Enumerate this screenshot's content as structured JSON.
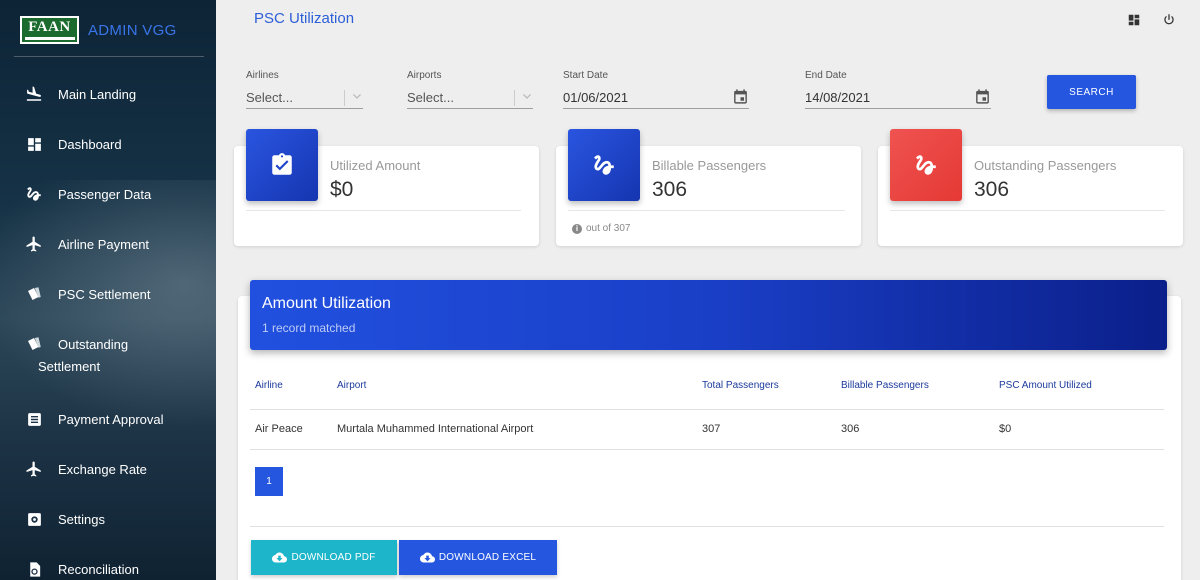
{
  "brand": {
    "logo_text": "FAAN",
    "title": "ADMIN VGG"
  },
  "nav": [
    {
      "label": "Main Landing",
      "icon": "plane-landing-icon"
    },
    {
      "label": "Dashboard",
      "icon": "dashboard-icon"
    },
    {
      "label": "Passenger Data",
      "icon": "seat-icon"
    },
    {
      "label": "Airline Payment",
      "icon": "airplane-icon"
    },
    {
      "label": "PSC Settlement",
      "icon": "tickets-icon"
    },
    {
      "label": "Outstanding",
      "label2": "Settlement",
      "icon": "tickets-icon"
    },
    {
      "label": "Payment Approval",
      "icon": "list-icon"
    },
    {
      "label": "Exchange Rate",
      "icon": "airplane-icon"
    },
    {
      "label": "Settings",
      "icon": "gear-icon"
    },
    {
      "label": "Reconciliation",
      "icon": "reconcile-icon"
    }
  ],
  "header": {
    "title": "PSC Utilization"
  },
  "filters": {
    "airlines": {
      "label": "Airlines",
      "value": "Select..."
    },
    "airports": {
      "label": "Airports",
      "value": "Select..."
    },
    "start_date": {
      "label": "Start Date",
      "value": "01/06/2021"
    },
    "end_date": {
      "label": "End Date",
      "value": "14/08/2021"
    },
    "search_label": "SEARCH"
  },
  "cards": [
    {
      "label": "Utilized Amount",
      "value": "$0",
      "color": "#1e40c4"
    },
    {
      "label": "Billable Passengers",
      "value": "306",
      "footer": "out of 307",
      "color": "#1e40c4"
    },
    {
      "label": "Outstanding Passengers",
      "value": "306",
      "color": "#e53935"
    }
  ],
  "panel": {
    "title": "Amount Utilization",
    "subtitle": "1 record matched",
    "columns": [
      "Airline",
      "Airport",
      "Total Passengers",
      "Billable Passengers",
      "PSC Amount Utilized"
    ],
    "rows": [
      [
        "Air Peace",
        "Murtala Muhammed International Airport",
        "307",
        "306",
        "$0"
      ]
    ],
    "page": "1",
    "download_pdf": "DOWNLOAD PDF",
    "download_excel": "DOWNLOAD EXCEL"
  },
  "colors": {
    "accent": "#2556e0",
    "teal": "#1cb5c9",
    "danger": "#e53935"
  }
}
